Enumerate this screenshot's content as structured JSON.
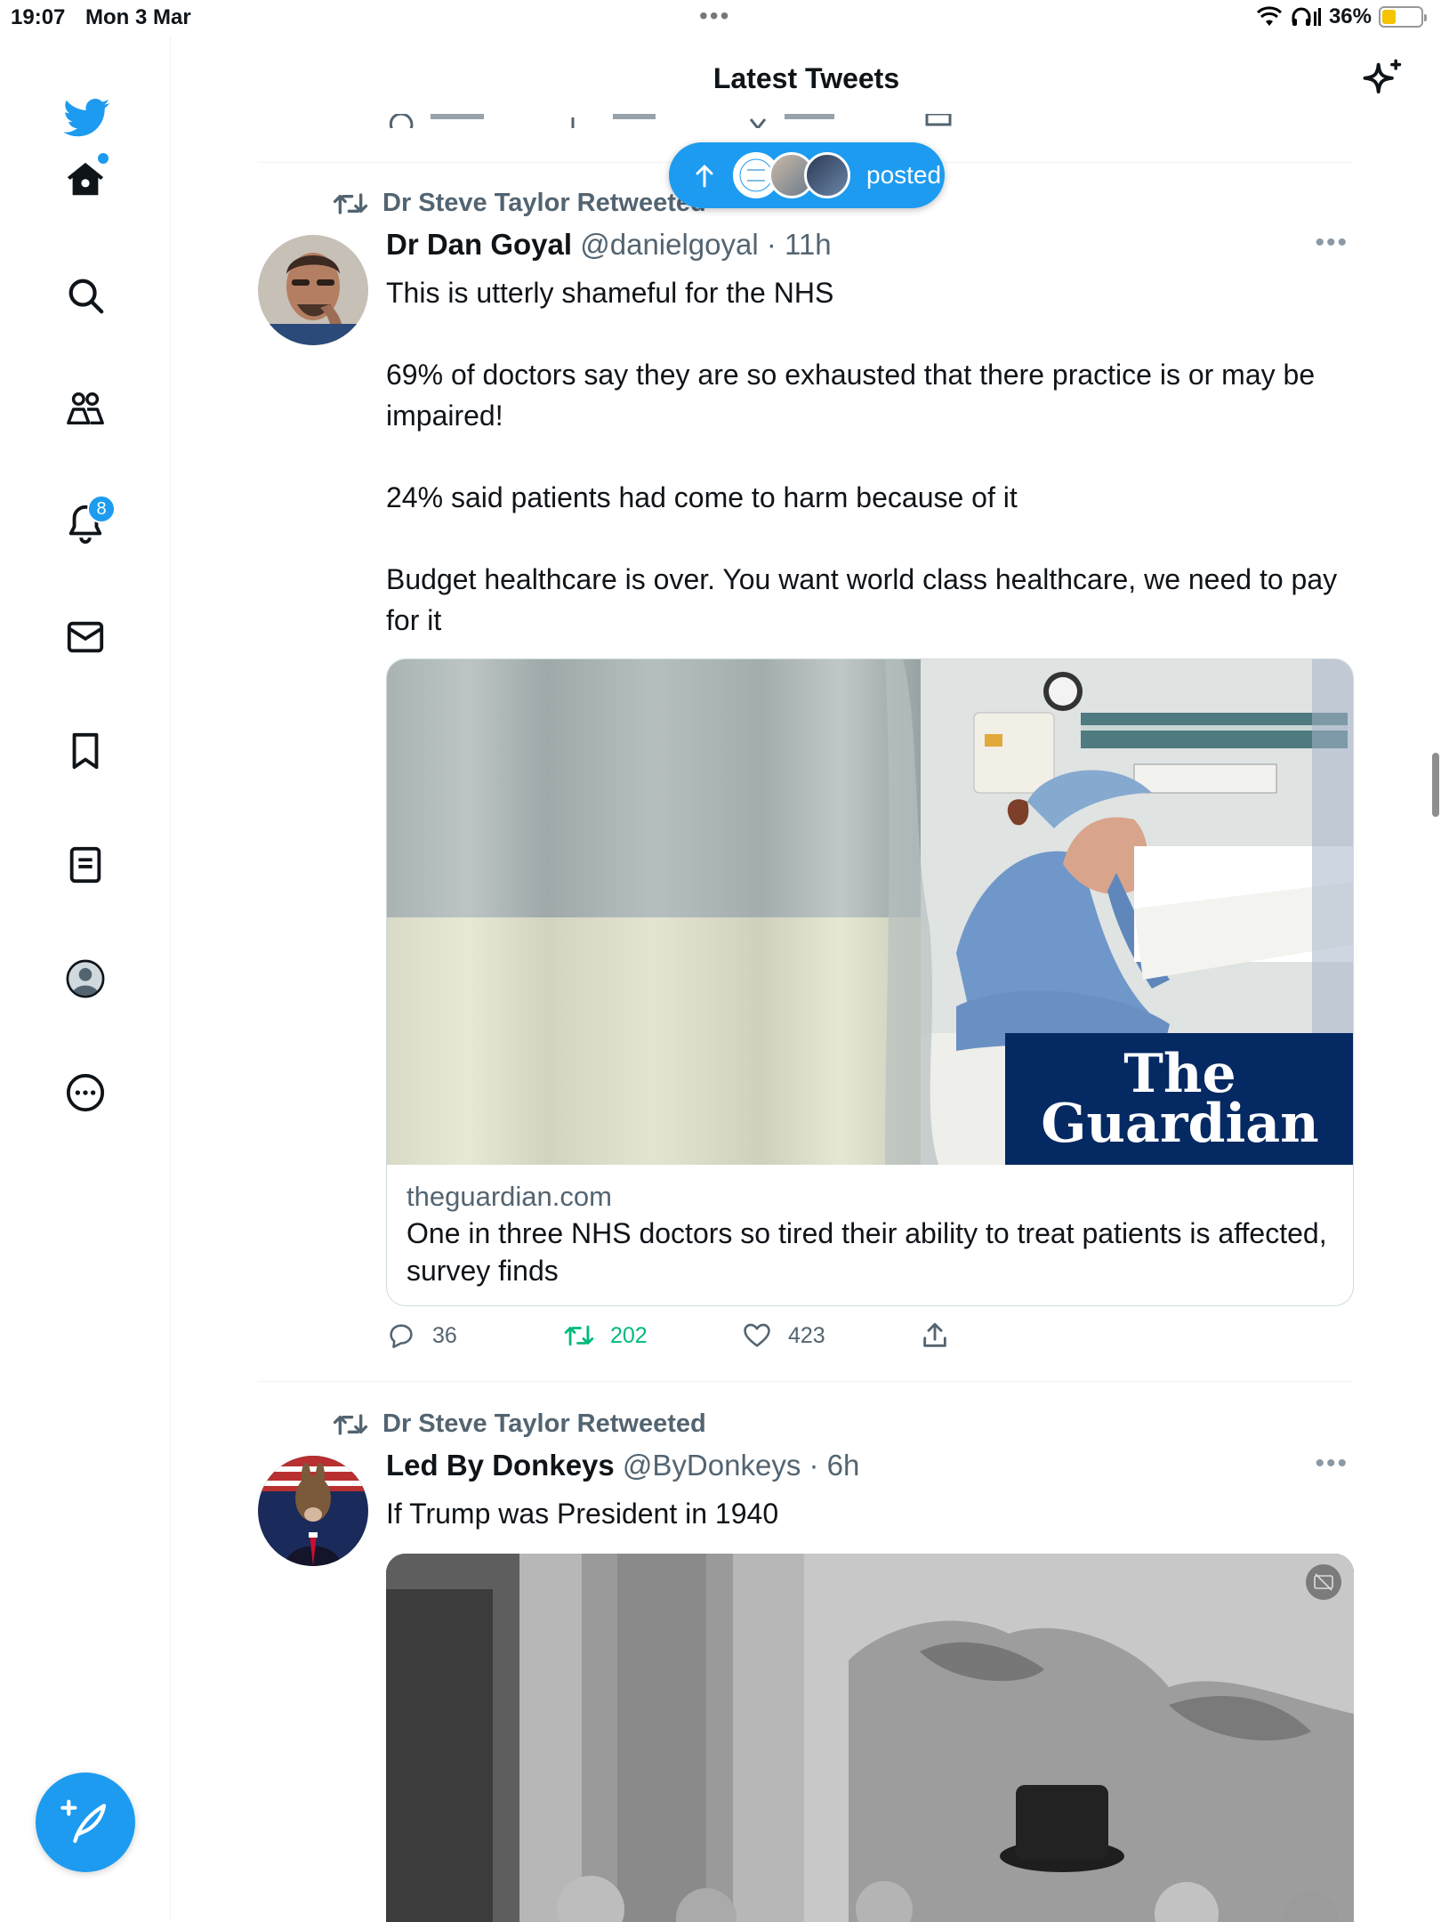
{
  "status_bar": {
    "time": "19:07",
    "date": "Mon 3 Mar",
    "battery": "36%",
    "battery_level": 0.36
  },
  "header": {
    "title": "Latest Tweets"
  },
  "sidebar": {
    "items": [
      {
        "name": "home",
        "icon": "home-icon"
      },
      {
        "name": "search",
        "icon": "search-icon"
      },
      {
        "name": "communities",
        "icon": "people-icon"
      },
      {
        "name": "notifications",
        "icon": "bell-icon",
        "badge": "8"
      },
      {
        "name": "messages",
        "icon": "mail-icon"
      },
      {
        "name": "bookmarks",
        "icon": "bookmark-icon"
      },
      {
        "name": "lists",
        "icon": "list-icon"
      },
      {
        "name": "profile",
        "icon": "avatar-icon"
      },
      {
        "name": "more",
        "icon": "more-circle-icon"
      }
    ]
  },
  "new_posts_pill": {
    "label": "posted"
  },
  "tweets": [
    {
      "retweeted_by": "Dr Steve Taylor Retweeted",
      "name": "Dr Dan Goyal",
      "handle": "@danielgoyal",
      "time": "11h",
      "paragraphs": [
        "This is utterly shameful for the NHS",
        "69% of doctors say they are so exhausted that there practice is or may be impaired!",
        "24% said patients had come to harm because of it",
        "Budget healthcare is over. You want world class healthcare, we need to pay for it"
      ],
      "card": {
        "logo_line1": "The",
        "logo_line2": "Guardian",
        "domain": "theguardian.com",
        "title": "One in three NHS doctors so tired their ability to treat patients is affected, survey finds"
      },
      "replies": "36",
      "retweets": "202",
      "likes": "423"
    },
    {
      "retweeted_by": "Dr Steve Taylor Retweeted",
      "name": "Led By Donkeys",
      "handle": "@ByDonkeys",
      "time": "6h",
      "text": "If Trump was President in 1940"
    }
  ],
  "colors": {
    "accent": "#1d9bf0",
    "retweet": "#00ba7c",
    "muted": "#536471",
    "guardian_blue": "#052962"
  }
}
